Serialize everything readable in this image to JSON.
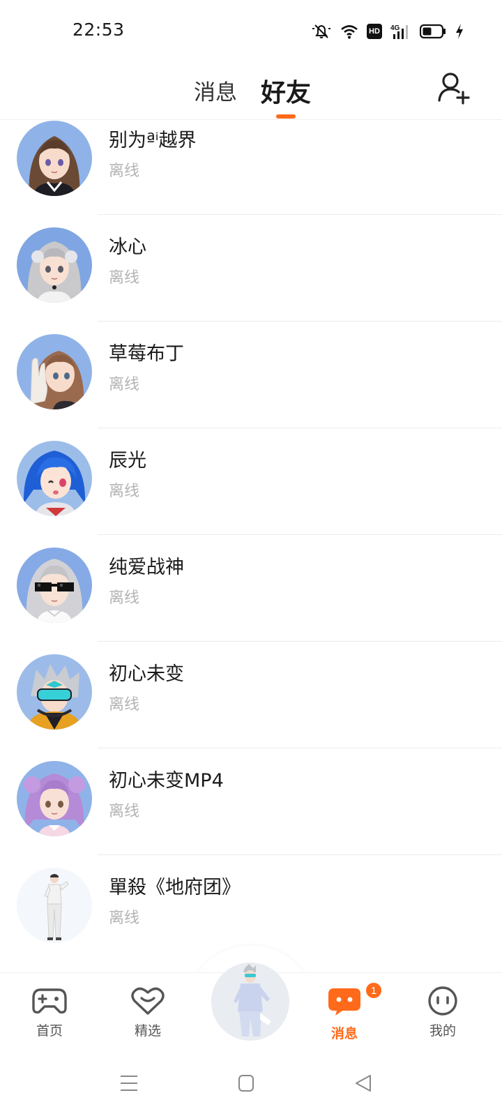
{
  "status_bar": {
    "time": "22:53",
    "hd_label": "HD",
    "network_label": "4G",
    "icons": [
      "mute-bell-icon",
      "wifi-icon",
      "hd-icon",
      "signal-4g-icon",
      "battery-icon",
      "charging-icon"
    ]
  },
  "header": {
    "tabs": [
      {
        "label": "消息",
        "active": false
      },
      {
        "label": "好友",
        "active": true
      }
    ],
    "add_friend_icon": "add-person-icon",
    "accent_color": "#ff6a1a"
  },
  "friends": [
    {
      "name": "别为ªⁱ越界",
      "status": "离线"
    },
    {
      "name": "冰心",
      "status": "离线"
    },
    {
      "name": "草莓布丁",
      "status": "离线"
    },
    {
      "name": "辰光",
      "status": "离线"
    },
    {
      "name": "纯爱战神",
      "status": "离线"
    },
    {
      "name": "初心未变",
      "status": "离线"
    },
    {
      "name": "初心未变MP4",
      "status": "离线"
    },
    {
      "name": "單殺《地府团》",
      "status": "离线"
    }
  ],
  "bottom_nav": {
    "items": [
      {
        "label": "首页",
        "icon": "gamepad-icon"
      },
      {
        "label": "精选",
        "icon": "heart-chat-icon"
      },
      {
        "label": "消息",
        "icon": "message-bubble-icon",
        "badge": "1",
        "active": true
      },
      {
        "label": "我的",
        "icon": "smiley-face-icon"
      }
    ]
  },
  "system_nav": {
    "icons": [
      "menu-icon",
      "home-icon",
      "back-icon"
    ]
  }
}
